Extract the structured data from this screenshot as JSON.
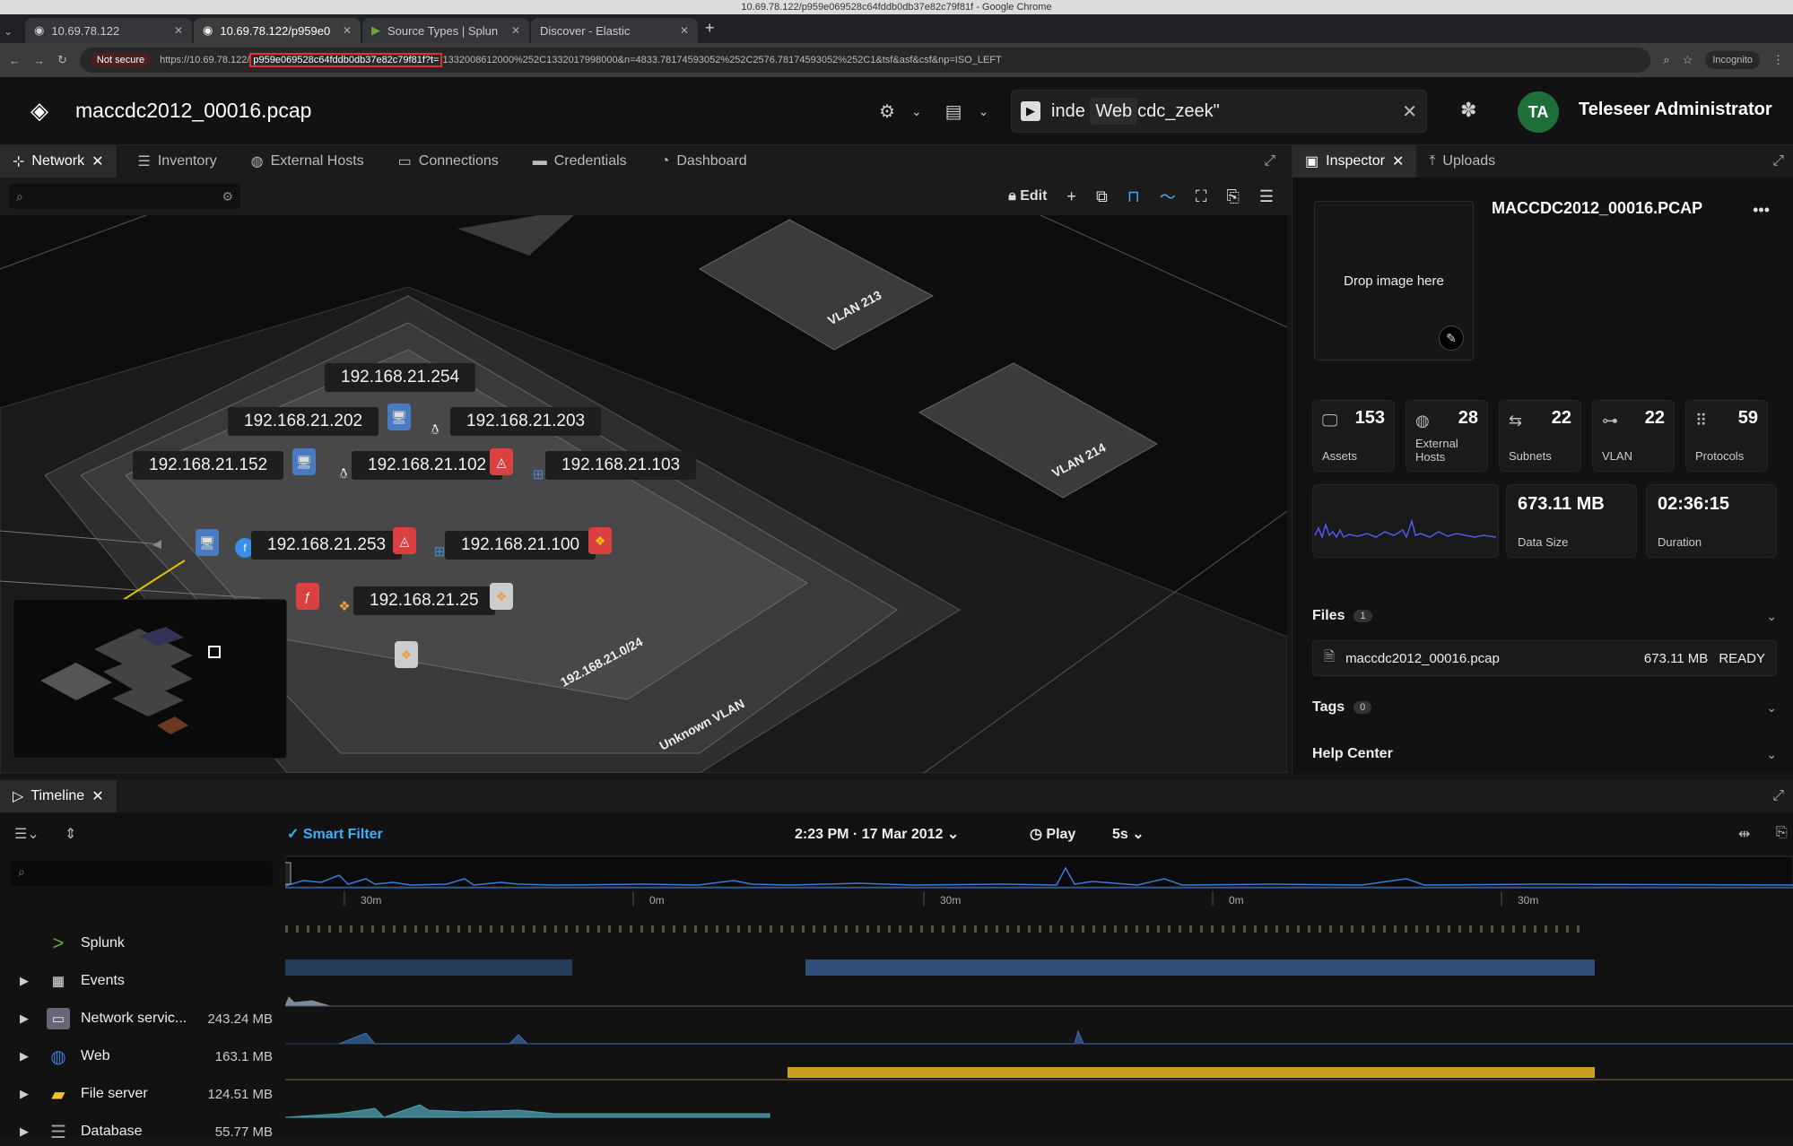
{
  "window": {
    "title": "10.69.78.122/p959e069528c64fddb0db37e82c79f81f - Google Chrome"
  },
  "browser_tabs": [
    {
      "label": "10.69.78.122",
      "active": false
    },
    {
      "label": "10.69.78.122/p959e0",
      "active": true
    },
    {
      "label": "Source Types | Splun",
      "active": false
    },
    {
      "label": "Discover - Elastic",
      "active": false
    }
  ],
  "address": {
    "security": "Not secure",
    "url_prefix": "https://10.69.78.122/",
    "url_highlight": "p959e069528c64fddb0db37e82c79f81f?t=",
    "url_rest": "1332008612000%252C1332017998000&n=4833.78174593052%252C2576.78174593052%252C1&tsf&asf&csf&np=ISO_LEFT",
    "mode": "Incognito"
  },
  "header": {
    "title": "maccdc2012_00016.pcap",
    "search_pre": "inde",
    "search_tooltip": "Web",
    "search_post": "cdc_zeek\"",
    "avatar": "TA",
    "user": "Teleseer Administrator"
  },
  "app_tabs": [
    "Network",
    "Inventory",
    "External Hosts",
    "Connections",
    "Credentials",
    "Dashboard"
  ],
  "map_tools": {
    "edit": "Edit"
  },
  "map": {
    "ips": {
      "a254": "192.168.21.254",
      "a202": "192.168.21.202",
      "a203": "192.168.21.203",
      "a152": "192.168.21.152",
      "a102": "192.168.21.102",
      "a103": "192.168.21.103",
      "a253": "192.168.21.253",
      "a100": "192.168.21.100",
      "a25": "192.168.21.25"
    },
    "vlan213": "VLAN 213",
    "vlan214": "VLAN 214",
    "subnet": "192.168.21.0/24",
    "unknown_vlan": "Unknown VLAN"
  },
  "inspector": {
    "tabs": [
      "Inspector",
      "Uploads"
    ],
    "drop_text": "Drop image here",
    "title": "MACCDC2012_00016.PCAP",
    "stats": [
      {
        "value": "153",
        "label": "Assets",
        "icon": "monitor-icon"
      },
      {
        "value": "28",
        "label": "External Hosts",
        "icon": "globe-icon"
      },
      {
        "value": "22",
        "label": "Subnets",
        "icon": "arrows-icon"
      },
      {
        "value": "22",
        "label": "VLAN",
        "icon": "network-icon"
      },
      {
        "value": "59",
        "label": "Protocols",
        "icon": "binary-icon"
      }
    ],
    "data_size": {
      "value": "673.11 MB",
      "label": "Data Size"
    },
    "duration": {
      "value": "02:36:15",
      "label": "Duration"
    },
    "files": {
      "label": "Files",
      "count": "1",
      "items": [
        {
          "name": "maccdc2012_00016.pcap",
          "size": "673.11 MB",
          "status": "READY"
        }
      ]
    },
    "tags": {
      "label": "Tags",
      "count": "0"
    },
    "help": {
      "label": "Help Center"
    }
  },
  "timeline": {
    "tab": "Timeline",
    "smart_filter": "Smart Filter",
    "datetime": "2:23 PM · 17 Mar 2012",
    "play": "Play",
    "speed": "5s",
    "ticks": [
      "30m",
      "0m",
      "30m",
      "0m",
      "30m"
    ],
    "sources": [
      {
        "name": "Splunk",
        "size": "",
        "color": "#65a637",
        "expandable": false
      },
      {
        "name": "Events",
        "size": "",
        "color": "#cccccc",
        "expandable": true
      },
      {
        "name": "Network servic...",
        "size": "243.24 MB",
        "color": "#8aa0b0",
        "expandable": true
      },
      {
        "name": "Web",
        "size": "163.1 MB",
        "color": "#3a7bd5",
        "expandable": true
      },
      {
        "name": "File server",
        "size": "124.51 MB",
        "color": "#f2c12e",
        "expandable": true
      },
      {
        "name": "Database",
        "size": "55.77 MB",
        "color": "#9aa0a6",
        "expandable": true
      }
    ]
  }
}
